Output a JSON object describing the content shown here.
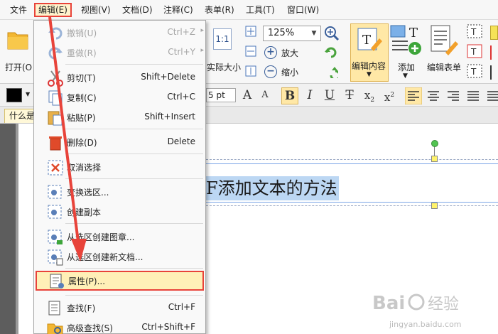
{
  "menubar": {
    "items": [
      {
        "label": "文件"
      },
      {
        "label": "编辑(E)"
      },
      {
        "label": "视图(V)"
      },
      {
        "label": "文档(D)"
      },
      {
        "label": "注释(C)"
      },
      {
        "label": "表单(R)"
      },
      {
        "label": "工具(T)"
      },
      {
        "label": "窗口(W)"
      }
    ]
  },
  "ribbon": {
    "open_label": "打开(O",
    "actual_size_label": "实际大小",
    "actual_size_icon_text": "1:1",
    "zoom_value": "125%",
    "zoom_in_label": "放大",
    "zoom_out_label": "缩小",
    "edit_content_label": "编辑内容",
    "add_label": "添加",
    "edit_form_label": "编辑表单"
  },
  "format": {
    "font_size": "5 pt",
    "text_color": "#000000"
  },
  "doc_tab": {
    "label": "什么是"
  },
  "document": {
    "text": "F添加文本的方法"
  },
  "edit_menu": {
    "items": [
      {
        "label": "撤销(U)",
        "shortcut": "Ctrl+Z",
        "icon": "undo-icon",
        "disabled": true,
        "submenu": true
      },
      {
        "label": "重做(R)",
        "shortcut": "Ctrl+Y",
        "icon": "redo-icon",
        "disabled": true,
        "submenu": true
      },
      {
        "label": "剪切(T)",
        "shortcut": "Shift+Delete",
        "icon": "cut-icon",
        "disabled": false
      },
      {
        "label": "复制(C)",
        "shortcut": "Ctrl+C",
        "icon": "copy-icon",
        "disabled": false
      },
      {
        "label": "粘贴(P)",
        "shortcut": "Shift+Insert",
        "icon": "paste-icon",
        "disabled": false
      },
      {
        "label": "删除(D)",
        "shortcut": "Delete",
        "icon": "delete-icon",
        "disabled": false
      },
      {
        "label": "取消选择",
        "shortcut": "",
        "icon": "deselect-icon",
        "disabled": false
      },
      {
        "label": "变换选区...",
        "shortcut": "",
        "icon": "transform-selection-icon",
        "disabled": false
      },
      {
        "label": "创建副本",
        "shortcut": "",
        "icon": "create-copy-icon",
        "disabled": false
      },
      {
        "label": "从选区创建图章...",
        "shortcut": "",
        "icon": "stamp-from-selection-icon",
        "disabled": false
      },
      {
        "label": "从选区创建新文档...",
        "shortcut": "",
        "icon": "new-document-from-selection-icon",
        "disabled": false
      },
      {
        "label": "属性(P)...",
        "shortcut": "",
        "icon": "properties-icon",
        "disabled": false
      },
      {
        "label": "查找(F)",
        "shortcut": "Ctrl+F",
        "icon": "find-icon",
        "disabled": false
      },
      {
        "label": "高级查找(S)",
        "shortcut": "Ctrl+Shift+F",
        "icon": "advanced-find-icon",
        "disabled": false
      }
    ]
  },
  "watermark": {
    "text": "jingyan.baidu.com"
  },
  "colors": {
    "highlight_border": "#e8433a",
    "menu_highlight": "#fff0b7",
    "text_selection": "#bcd7f3"
  }
}
